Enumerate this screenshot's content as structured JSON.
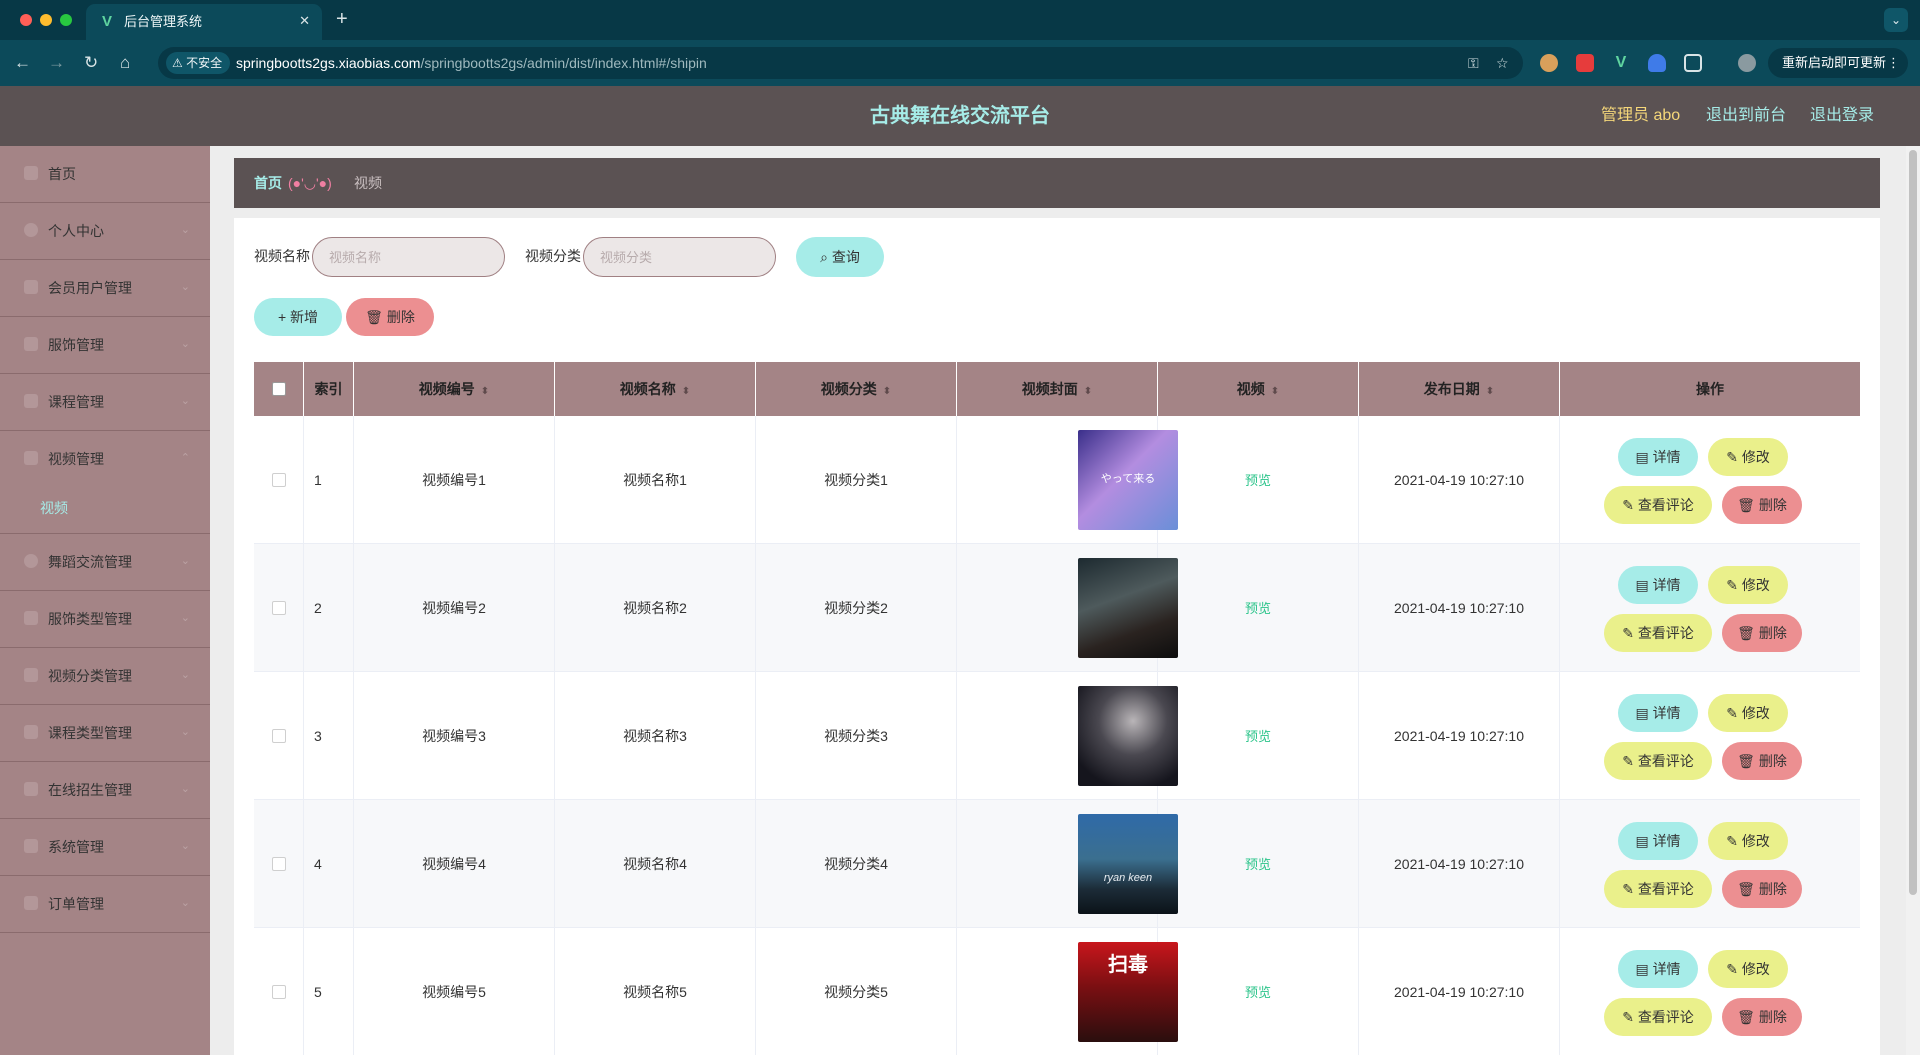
{
  "browser": {
    "tab_title": "后台管理系统",
    "tab_favicon": "V",
    "insecure_label": "不安全",
    "url_host": "springbootts2gs.xiaobias.com",
    "url_path": "/springbootts2gs/admin/dist/index.html#/shipin",
    "update_label": "重新启动即可更新",
    "new_tab": "+",
    "close_tab": "✕"
  },
  "header": {
    "title": "古典舞在线交流平台",
    "admin": "管理员 abo",
    "to_front": "退出到前台",
    "logout": "退出登录"
  },
  "sidebar": {
    "items": [
      {
        "label": "首页"
      },
      {
        "label": "个人中心"
      },
      {
        "label": "会员用户管理"
      },
      {
        "label": "服饰管理"
      },
      {
        "label": "课程管理"
      },
      {
        "label": "视频管理"
      },
      {
        "label": "舞蹈交流管理"
      },
      {
        "label": "服饰类型管理"
      },
      {
        "label": "视频分类管理"
      },
      {
        "label": "课程类型管理"
      },
      {
        "label": "在线招生管理"
      },
      {
        "label": "系统管理"
      },
      {
        "label": "订单管理"
      }
    ],
    "sub_active": "视频"
  },
  "breadcrumb": {
    "home": "首页",
    "face": "(●'◡'●)",
    "current": "视频"
  },
  "search": {
    "name_label": "视频名称",
    "name_placeholder": "视频名称",
    "category_label": "视频分类",
    "category_placeholder": "视频分类",
    "query_label": "查询"
  },
  "actions": {
    "add_label": "新增",
    "delete_label": "删除"
  },
  "table": {
    "columns": [
      "索引",
      "视频编号",
      "视频名称",
      "视频分类",
      "视频封面",
      "视频",
      "发布日期",
      "操作"
    ],
    "preview_label": "预览",
    "btn_detail": "详情",
    "btn_edit": "修改",
    "btn_comment": "查看评论",
    "btn_delete": "删除",
    "rows": [
      {
        "index": "1",
        "code": "视频编号1",
        "name": "视频名称1",
        "category": "视频分类1",
        "date": "2021-04-19 10:27:10",
        "cover_text": "やって来る"
      },
      {
        "index": "2",
        "code": "视频编号2",
        "name": "视频名称2",
        "category": "视频分类2",
        "date": "2021-04-19 10:27:10",
        "cover_text": ""
      },
      {
        "index": "3",
        "code": "视频编号3",
        "name": "视频名称3",
        "category": "视频分类3",
        "date": "2021-04-19 10:27:10",
        "cover_text": ""
      },
      {
        "index": "4",
        "code": "视频编号4",
        "name": "视频名称4",
        "category": "视频分类4",
        "date": "2021-04-19 10:27:10",
        "cover_text": "ryan keen"
      },
      {
        "index": "5",
        "code": "视频编号5",
        "name": "视频名称5",
        "category": "视频分类5",
        "date": "2021-04-19 10:27:10",
        "cover_text": "扫毒"
      }
    ]
  },
  "colors": {
    "header_bg": "#5b5253",
    "sidebar_bg": "#a48486",
    "accent_teal": "#a6ece8",
    "accent_yellow": "#eaf08b",
    "accent_red": "#ec8f91",
    "preview_green": "#2bc48a"
  }
}
